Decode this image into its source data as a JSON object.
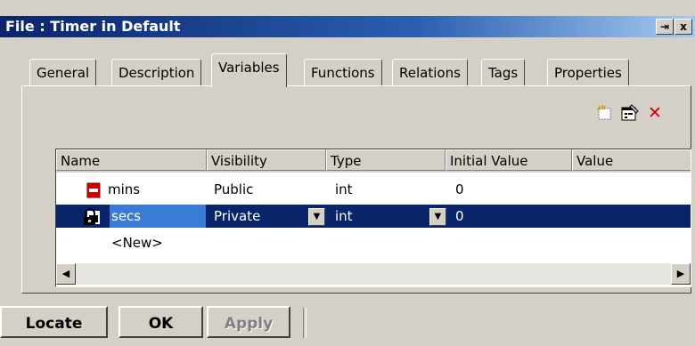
{
  "window": {
    "title": "File : Timer in Default",
    "title_buttons": [
      "⇥",
      "x"
    ]
  },
  "tabs": [
    "General",
    "Description",
    "Variables",
    "Functions",
    "Relations",
    "Tags",
    "Properties"
  ],
  "active_tab": "Variables",
  "toolbar": {
    "icons": [
      "new-variable-icon",
      "properties-icon",
      "delete-icon"
    ],
    "delete_glyph": "✕"
  },
  "grid": {
    "columns": [
      "Name",
      "Visibility",
      "Type",
      "Initial Value",
      "Value"
    ],
    "rows": [
      {
        "icon": "public-variable-icon",
        "name": "mins",
        "visibility": "Public",
        "type": "int",
        "initial": "0",
        "value": "",
        "selected": false
      },
      {
        "icon": "private-variable-icon",
        "name": "secs",
        "visibility": "Private",
        "type": "int",
        "initial": "0",
        "value": "",
        "selected": true
      }
    ],
    "new_row": "<New>"
  },
  "buttons": {
    "locate": "Locate",
    "ok": "OK",
    "apply": "Apply"
  },
  "colors": {
    "selection": "#0a246a",
    "titlebar": "#0a246a",
    "face": "#d4d0c8",
    "delete": "#cc0000",
    "public_icon": "#d40000"
  }
}
